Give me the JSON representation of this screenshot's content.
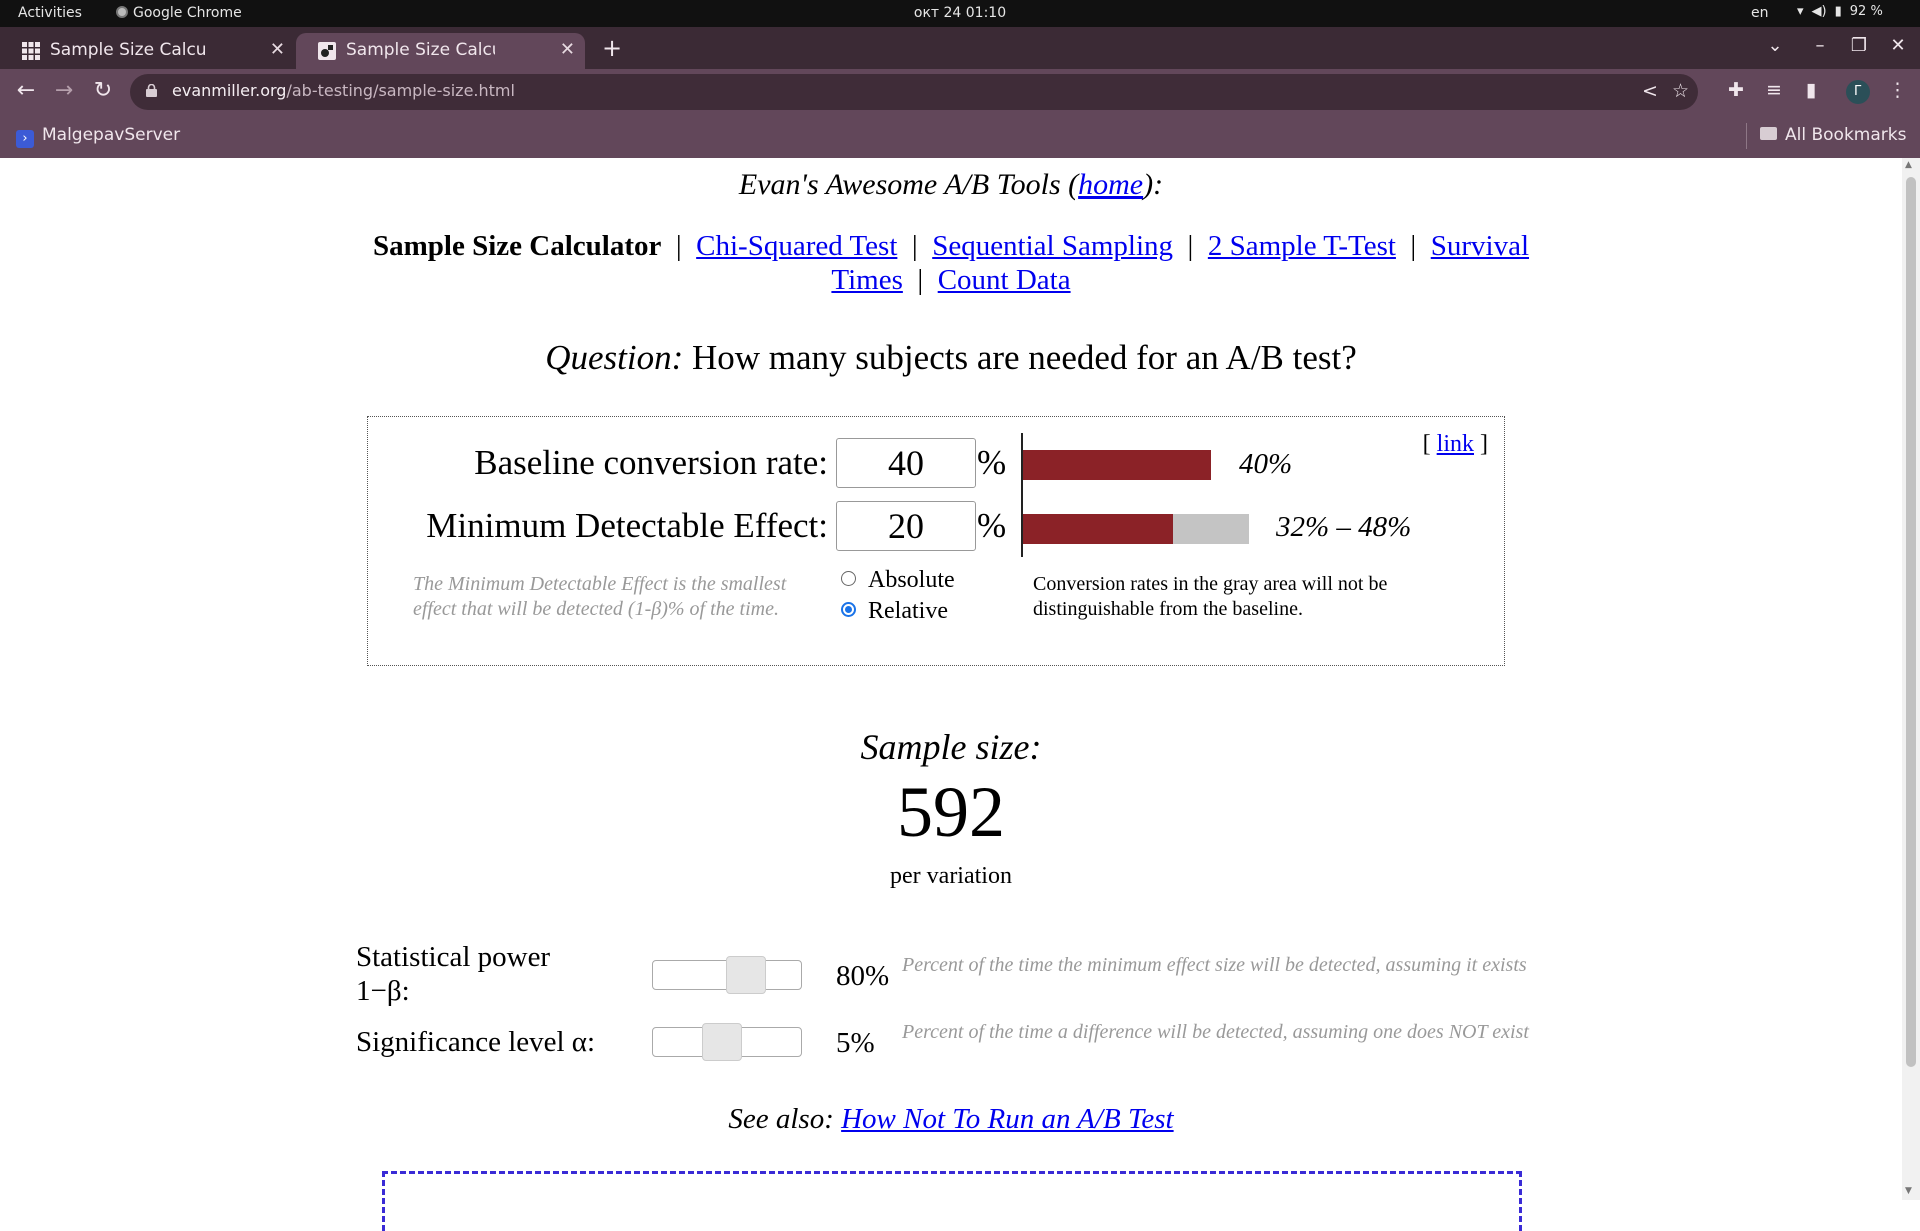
{
  "topbar": {
    "activities": "Activities",
    "app": "Google Chrome",
    "clock": "окт 24  01:10",
    "lang": "en",
    "battery": "92 %"
  },
  "tabs": [
    {
      "title": "Sample Size Calculator fo",
      "favicon": "grid-icon"
    },
    {
      "title": "Sample Size Calculator (E",
      "favicon": "evan-miller-icon",
      "active": true
    }
  ],
  "omnibox": {
    "domain": "evanmiller.org",
    "path": "/ab-testing/sample-size.html"
  },
  "bookmarks": {
    "item1": "MalgepavServer",
    "all": "All Bookmarks"
  },
  "page": {
    "tools_header_prefix": "Evan's Awesome A/B Tools (",
    "tools_header_link": "home",
    "tools_header_suffix": "):",
    "nav": {
      "current": "Sample Size Calculator",
      "sep": "|",
      "chi": "Chi-Squared Test",
      "seq": "Sequential Sampling",
      "ttest": "2 Sample T-Test",
      "survival_a": "Survival",
      "survival_b": "Times",
      "count": "Count Data"
    },
    "question_label": "Question:",
    "question_text": " How many subjects are needed for an A/B test?",
    "calc": {
      "link_open": "[ ",
      "link_text": "link",
      "link_close": " ]",
      "baseline_label": "Baseline conversion rate:",
      "baseline_value": "40",
      "mde_label": "Minimum Detectable Effect:",
      "mde_value": "20",
      "pct": "%",
      "baseline_bar_label": "40%",
      "baseline_fraction": 0.4,
      "mde_bar_label": "32% – 48%",
      "mde_low_fraction": 0.32,
      "mde_high_fraction": 0.48,
      "mde_note": "The Minimum Detectable Effect is the smallest effect that will be detected (1-β)% of the time.",
      "radio_absolute": "Absolute",
      "radio_relative": "Relative",
      "selected_mode": "Relative",
      "gray_note": "Conversion rates in the gray area will not be distinguishable from the baseline."
    },
    "sample_title": "Sample size:",
    "sample_value": "592",
    "per_variation": "per variation",
    "power": {
      "label_line1": "Statistical power",
      "label_line2": "1−β:",
      "value": "80%",
      "level": 0.8,
      "note": "Percent of the time the minimum effect size will be detected, assuming it exists"
    },
    "significance": {
      "label": "Significance level α:",
      "value": "5%",
      "level": 0.05,
      "note": "Percent of the time a difference will be detected, assuming one does NOT exist"
    },
    "see_also_label": "See also: ",
    "see_also_link": "How Not To Run an A/B Test"
  },
  "colors": {
    "bar_red": "#8b2227",
    "bar_gray": "#c4c4c4",
    "link": "#0000ee",
    "chrome_frame": "#62475a"
  }
}
